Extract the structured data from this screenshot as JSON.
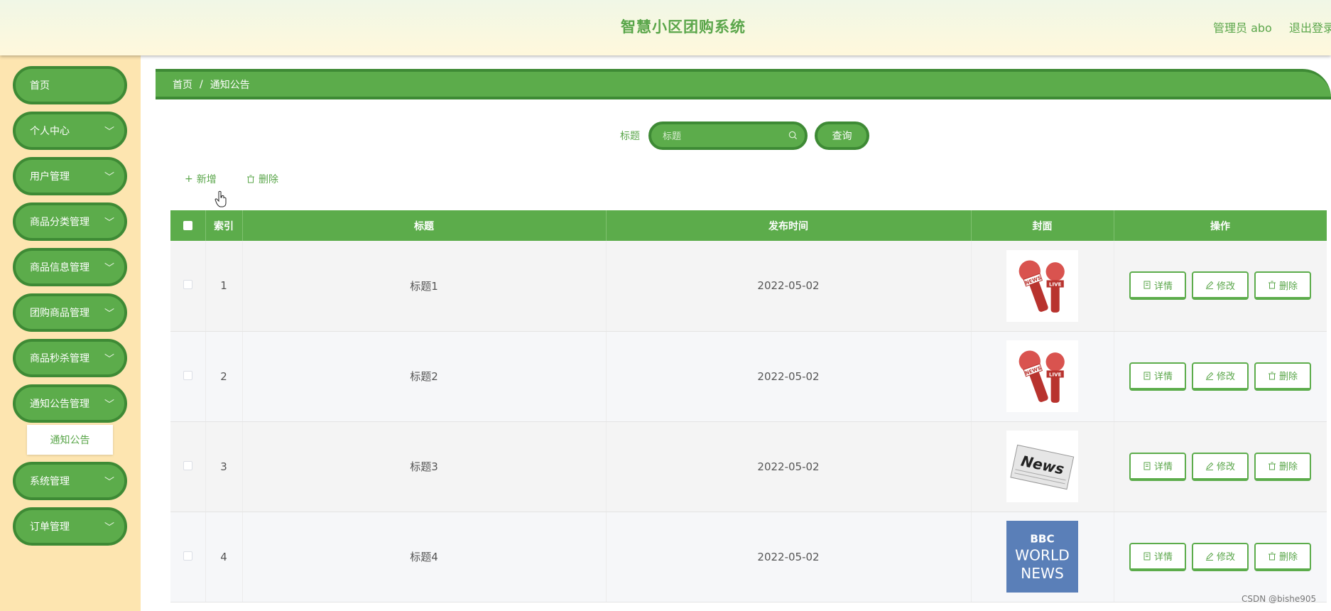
{
  "header": {
    "title": "智慧小区团购系统",
    "admin_label": "管理员 abo",
    "logout_label": "退出登录"
  },
  "sidebar": {
    "items": [
      {
        "label": "首页"
      },
      {
        "label": "个人中心"
      },
      {
        "label": "用户管理"
      },
      {
        "label": "商品分类管理"
      },
      {
        "label": "商品信息管理"
      },
      {
        "label": "团购商品管理"
      },
      {
        "label": "商品秒杀管理"
      },
      {
        "label": "通知公告管理"
      },
      {
        "label": "系统管理"
      },
      {
        "label": "订单管理"
      }
    ],
    "sub_item": {
      "label": "通知公告"
    }
  },
  "breadcrumb": {
    "home": "首页",
    "separator": "/",
    "current": "通知公告"
  },
  "search": {
    "label": "标题",
    "placeholder": "标题",
    "button_label": "查询"
  },
  "toolbar": {
    "add_label": "新增",
    "delete_label": "删除"
  },
  "table": {
    "headers": {
      "index": "索引",
      "title": "标题",
      "publish_time": "发布时间",
      "cover": "封面",
      "actions": "操作"
    },
    "rows": [
      {
        "index": "1",
        "title": "标题1",
        "publish_time": "2022-05-02",
        "cover": "news-microphone-icon"
      },
      {
        "index": "2",
        "title": "标题2",
        "publish_time": "2022-05-02",
        "cover": "news-microphone-icon"
      },
      {
        "index": "3",
        "title": "标题3",
        "publish_time": "2022-05-02",
        "cover": "news-paper-icon"
      },
      {
        "index": "4",
        "title": "标题4",
        "publish_time": "2022-05-02",
        "cover": "bbc-world-news-logo"
      }
    ],
    "actions": {
      "detail": "详情",
      "edit": "修改",
      "delete": "删除"
    }
  },
  "cover_text": {
    "bbc_line1": "BBC",
    "bbc_line2": "WORLD",
    "bbc_line3": "NEWS",
    "news_word": "News",
    "mic_tag": "NEWS",
    "mic_tag2": "LIVE"
  },
  "watermark": "CSDN @bishe905",
  "colors": {
    "primary": "#5cac4b",
    "primary_dark": "#3e8a35",
    "sidebar_bg": "#fde5b0",
    "text_green": "#5aa64a"
  }
}
